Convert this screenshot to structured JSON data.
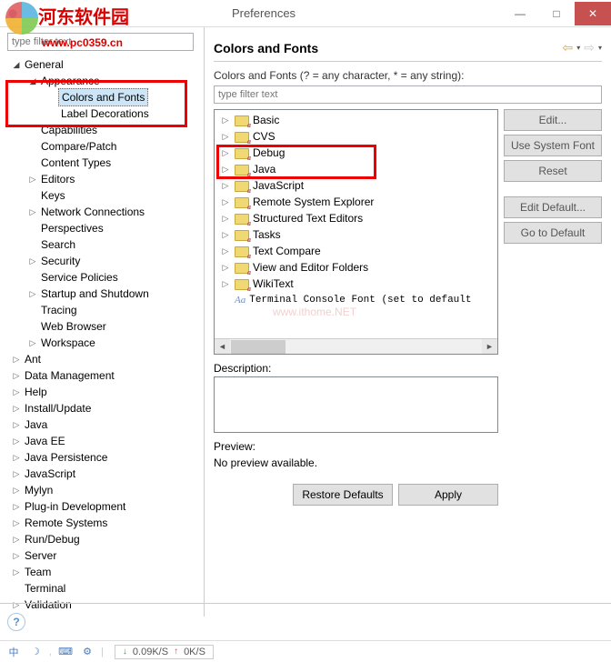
{
  "window": {
    "title": "Preferences",
    "close": "✕",
    "max": "□",
    "min": "—"
  },
  "logo": {
    "text": "河东软件园",
    "url": "www.pc0359.cn"
  },
  "leftFilter": {
    "placeholder": "type filter text"
  },
  "leftTree": {
    "general": "General",
    "appearance": "Appearance",
    "colorsFonts": "Colors and Fonts",
    "labelDec": "Label Decorations",
    "capabilities": "Capabilities",
    "comparePatch": "Compare/Patch",
    "contentTypes": "Content Types",
    "editors": "Editors",
    "keys": "Keys",
    "netConn": "Network Connections",
    "perspectives": "Perspectives",
    "search": "Search",
    "security": "Security",
    "servicePolicies": "Service Policies",
    "startup": "Startup and Shutdown",
    "tracing": "Tracing",
    "webBrowser": "Web Browser",
    "workspace": "Workspace",
    "ant": "Ant",
    "dataMgmt": "Data Management",
    "help": "Help",
    "installUpdate": "Install/Update",
    "java": "Java",
    "javaEE": "Java EE",
    "javaPersist": "Java Persistence",
    "javascript": "JavaScript",
    "mylyn": "Mylyn",
    "plugin": "Plug-in Development",
    "remote": "Remote Systems",
    "runDebug": "Run/Debug",
    "server": "Server",
    "team": "Team",
    "terminal": "Terminal",
    "validation": "Validation"
  },
  "right": {
    "title": "Colors and Fonts",
    "hint": "Colors and Fonts (? = any character, * = any string):",
    "filterPlaceholder": "type filter text",
    "tree": {
      "basic": "Basic",
      "cvs": "CVS",
      "debug": "Debug",
      "java": "Java",
      "javascript": "JavaScript",
      "remote": "Remote System Explorer",
      "structured": "Structured Text Editors",
      "tasks": "Tasks",
      "textcompare": "Text Compare",
      "vieweditor": "View and Editor Folders",
      "wikitext": "WikiText",
      "terminal": "Terminal Console Font (set to default"
    },
    "btns": {
      "edit": "Edit...",
      "sysfont": "Use System Font",
      "reset": "Reset",
      "editDefault": "Edit Default...",
      "goDefault": "Go to Default"
    },
    "descLabel": "Description:",
    "previewLabel": "Preview:",
    "noPreview": "No preview available.",
    "restore": "Restore Defaults",
    "apply": "Apply"
  },
  "watermark": "www.ithome.NET",
  "status": {
    "down": "0.09K/S",
    "up": "0K/S"
  }
}
